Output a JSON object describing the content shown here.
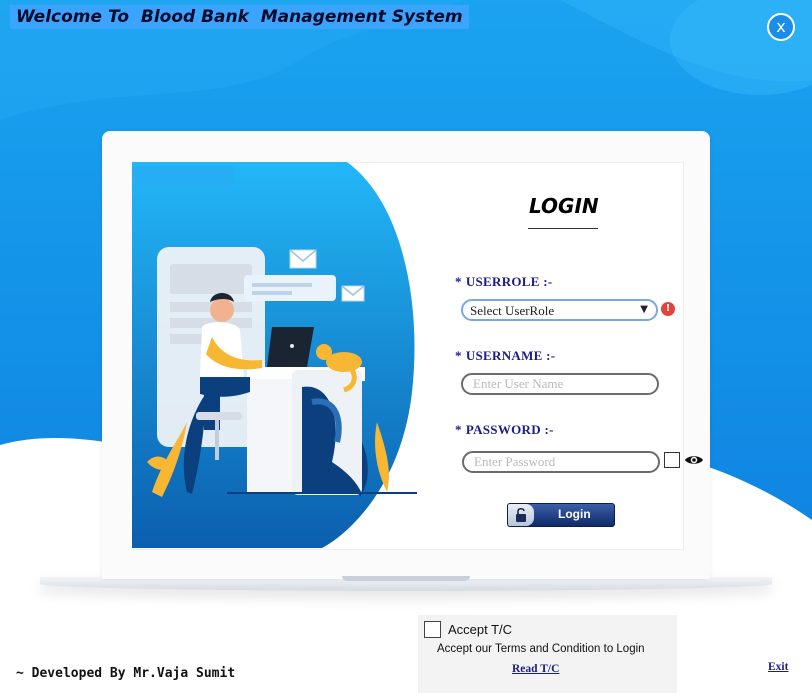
{
  "window": {
    "title": "Welcome To  Blood Bank  Management System",
    "close_label": "x"
  },
  "login": {
    "heading": "LOGIN",
    "userrole_label": "USERROLE  :-",
    "userrole_value": "Select UserRole",
    "username_label": "USERNAME  :-",
    "username_placeholder": "Enter User Name",
    "password_label": "PASSWORD :-",
    "password_placeholder": "Enter Password",
    "required_marker": "*",
    "error_icon": "!",
    "login_button": "Login"
  },
  "terms": {
    "checkbox_label": "Accept T/C",
    "subtext": "Accept our Terms and Condition to Login",
    "link": "Read T/C"
  },
  "footer": {
    "credit": "~ Developed By Mr.Vaja Sumit",
    "exit": "Exit"
  },
  "colors": {
    "accent": "#1a8de8",
    "label": "#1b1b8a",
    "error": "#e0443a"
  },
  "icons": {
    "close": "close-icon",
    "error": "error-icon",
    "eye": "eye-icon",
    "lock": "lock-icon",
    "chevron": "chevron-down-icon"
  }
}
